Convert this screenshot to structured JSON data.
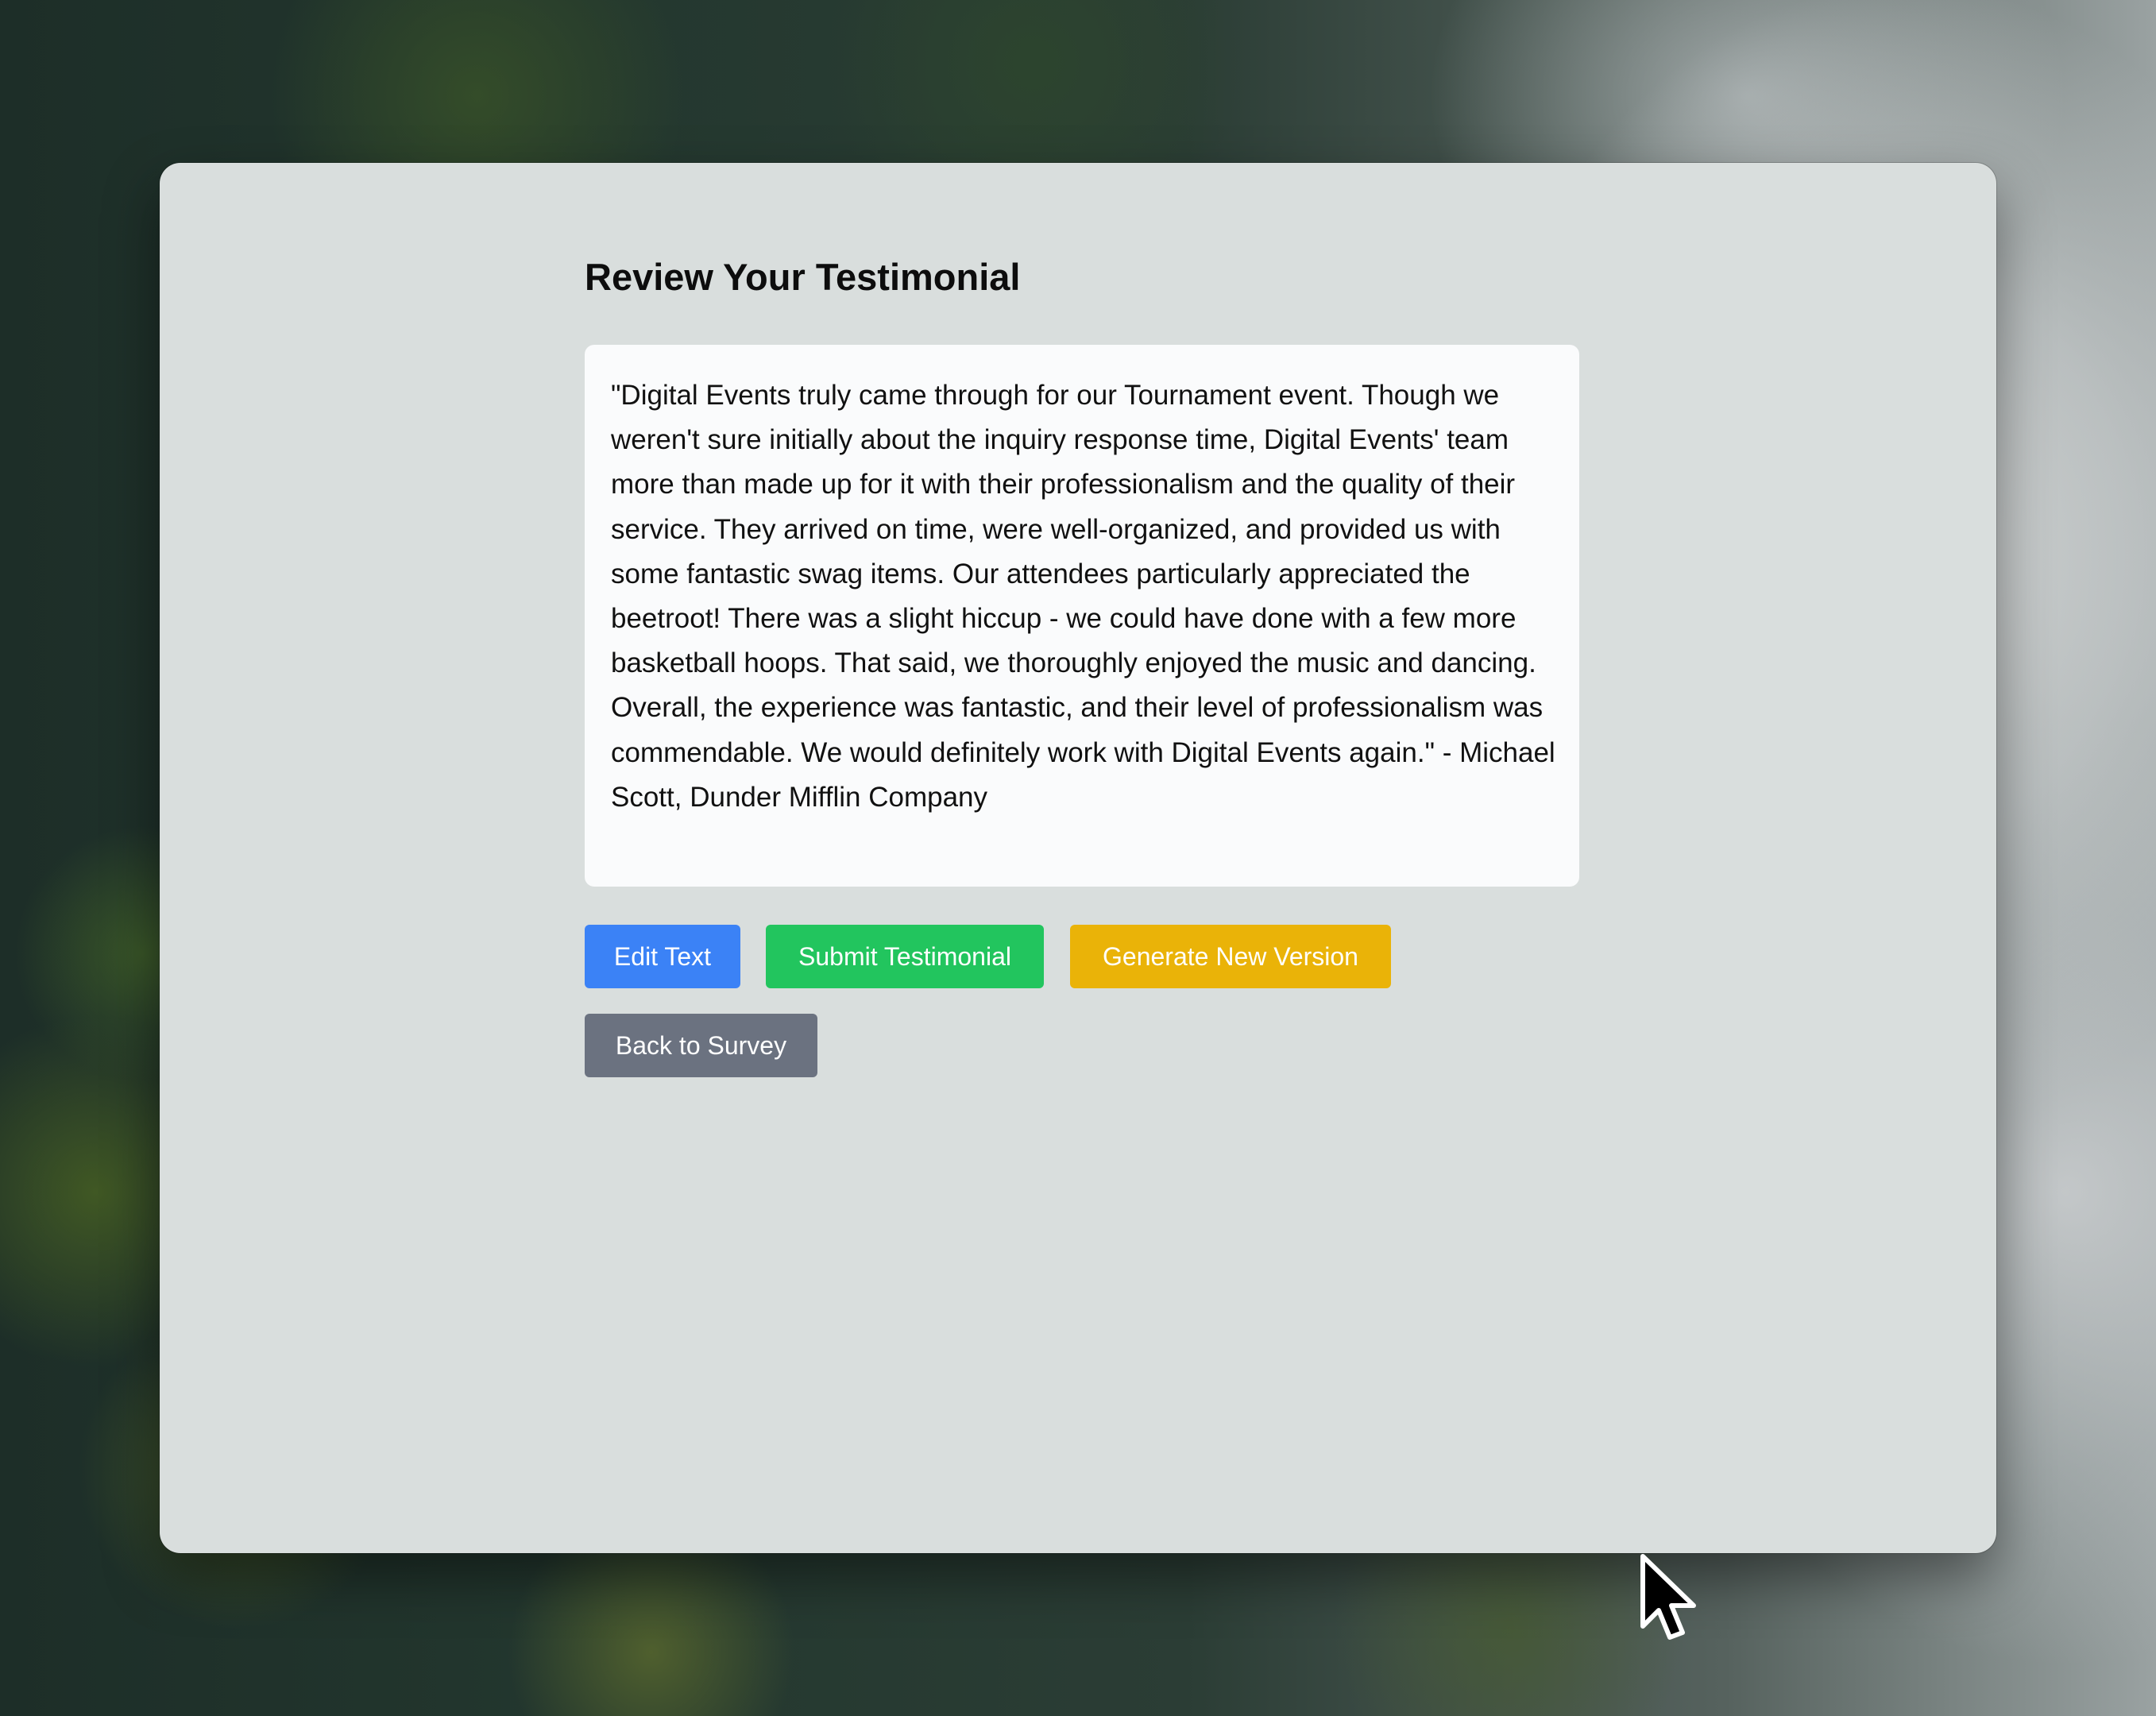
{
  "page": {
    "title": "Review Your Testimonial"
  },
  "testimonial": {
    "text": "\"Digital Events truly came through for our Tournament event. Though we weren't sure initially about the inquiry response time, Digital Events' team more than made up for it with their professionalism and the quality of their service. They arrived on time, were well-organized, and provided us with some fantastic swag items. Our attendees particularly appreciated the beetroot! There was a slight hiccup - we could have done with a few more basketball hoops. That said, we thoroughly enjoyed the music and dancing. Overall, the experience was fantastic, and their level of professionalism was commendable. We would definitely work with Digital Events again.\" - Michael Scott, Dunder Mifflin Company"
  },
  "actions": {
    "edit_label": "Edit Text",
    "submit_label": "Submit Testimonial",
    "generate_label": "Generate New Version",
    "back_label": "Back to Survey"
  },
  "colors": {
    "edit": "#3b82f6",
    "submit": "#22c55e",
    "generate": "#eab308",
    "back": "#6b7280",
    "window_bg": "#d9dedd",
    "card_bg": "#fafbfc"
  },
  "icons": {
    "cursor": "mouse-pointer-icon"
  }
}
